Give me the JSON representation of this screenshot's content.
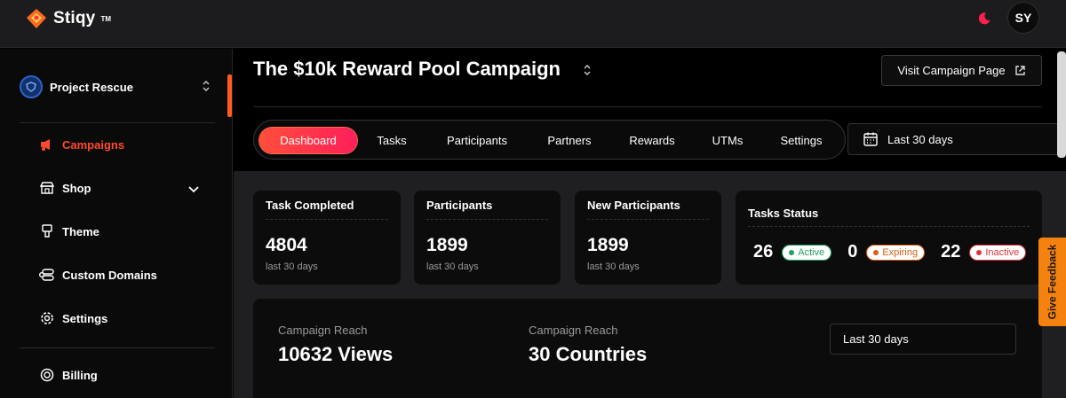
{
  "brand": {
    "name": "Stiqy",
    "tm": "TM"
  },
  "header": {
    "avatar_initials": "SY",
    "theme_icon": "moon-icon"
  },
  "sidebar": {
    "project": "Project Rescue",
    "items": [
      {
        "label": "Campaigns",
        "icon": "megaphone-icon",
        "active": true
      },
      {
        "label": "Shop",
        "icon": "store-icon"
      },
      {
        "label": "Theme",
        "icon": "brush-icon"
      },
      {
        "label": "Custom Domains",
        "icon": "domains-icon"
      },
      {
        "label": "Settings",
        "icon": "gear-icon"
      },
      {
        "label": "Billing",
        "icon": "billing-icon"
      }
    ]
  },
  "campaign": {
    "title": "The $10k Reward Pool Campaign",
    "visit_label": "Visit Campaign Page",
    "tabs": [
      "Dashboard",
      "Tasks",
      "Participants",
      "Partners",
      "Rewards",
      "UTMs",
      "Settings"
    ],
    "active_tab": "Dashboard",
    "date_range": "Last 30 days"
  },
  "stats": {
    "task_completed": {
      "title": "Task Completed",
      "value": "4804",
      "sub": "last 30 days"
    },
    "participants": {
      "title": "Participants",
      "value": "1899",
      "sub": "last 30 days"
    },
    "new_participants": {
      "title": "New Participants",
      "value": "1899",
      "sub": "last 30 days"
    },
    "tasks_status": {
      "title": "Tasks Status",
      "active_count": "26",
      "active_label": "Active",
      "expiring_count": "0",
      "expiring_label": "Expiring",
      "inactive_count": "22",
      "inactive_label": "Inactive"
    }
  },
  "reach": {
    "views_label": "Campaign Reach",
    "views_value": "10632 Views",
    "countries_label": "Campaign Reach",
    "countries_value": "30 Countries",
    "date_range": "Last 30 days"
  },
  "feedback_label": "Give Feedback",
  "colors": {
    "accent": "#ff4a2e",
    "feedback": "#f5820f",
    "active_green": "#1fa35c",
    "expiring_orange": "#e05a10",
    "inactive_red": "#e0323a"
  }
}
